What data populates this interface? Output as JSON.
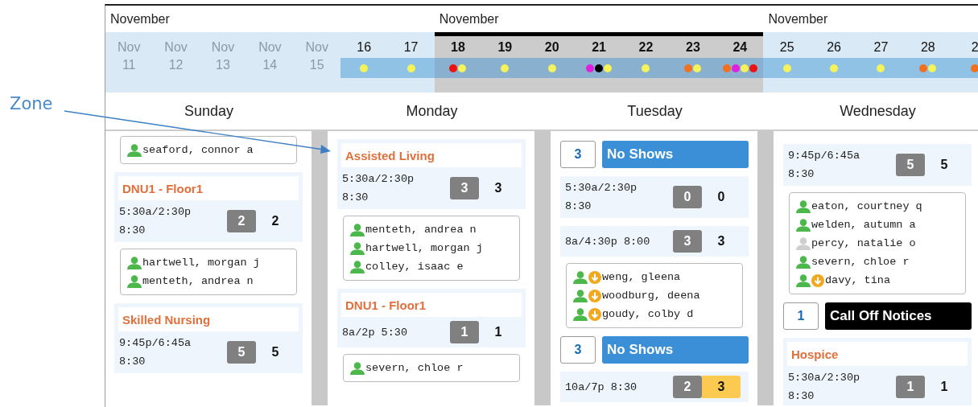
{
  "annotation": {
    "label": "Zone"
  },
  "months": [
    {
      "label": "November"
    },
    {
      "label": "November"
    },
    {
      "label": "November"
    }
  ],
  "dates": [
    {
      "month": "Nov",
      "day": "11",
      "available": false,
      "selected": false
    },
    {
      "month": "Nov",
      "day": "12",
      "available": false,
      "selected": false
    },
    {
      "month": "Nov",
      "day": "13",
      "available": false,
      "selected": false
    },
    {
      "month": "Nov",
      "day": "14",
      "available": false,
      "selected": false
    },
    {
      "month": "Nov",
      "day": "15",
      "available": false,
      "selected": false
    },
    {
      "day": "16",
      "available": true,
      "selected": false,
      "dots": [
        {
          "color": "#f4f45a"
        }
      ]
    },
    {
      "day": "17",
      "available": true,
      "selected": false,
      "dots": [
        {
          "color": "#f4f45a"
        }
      ]
    },
    {
      "day": "18",
      "available": true,
      "selected": true,
      "dots": [
        {
          "color": "#ee1111"
        },
        {
          "color": "#f4f45a"
        }
      ]
    },
    {
      "day": "19",
      "available": true,
      "selected": true,
      "dots": [
        {
          "color": "#f4f45a"
        }
      ]
    },
    {
      "day": "20",
      "available": true,
      "selected": true,
      "dots": [
        {
          "color": "#f4f45a"
        }
      ]
    },
    {
      "day": "21",
      "available": true,
      "selected": true,
      "dots": [
        {
          "color": "#e020e0"
        },
        {
          "color": "#000000"
        },
        {
          "color": "#f4f45a"
        }
      ]
    },
    {
      "day": "22",
      "available": true,
      "selected": true,
      "dots": [
        {
          "color": "#f4f45a"
        }
      ]
    },
    {
      "day": "23",
      "available": true,
      "selected": true,
      "dots": [
        {
          "color": "#f07020"
        },
        {
          "color": "#f4f45a"
        }
      ]
    },
    {
      "day": "24",
      "available": true,
      "selected": true,
      "dots": [
        {
          "color": "#f07020"
        },
        {
          "color": "#e020e0"
        },
        {
          "color": "#f4f45a"
        },
        {
          "color": "#ee1111"
        }
      ]
    },
    {
      "day": "25",
      "available": true,
      "selected": false,
      "dots": [
        {
          "color": "#f4f45a"
        }
      ]
    },
    {
      "day": "26",
      "available": true,
      "selected": false,
      "dots": [
        {
          "color": "#f4f45a"
        }
      ]
    },
    {
      "day": "27",
      "available": true,
      "selected": false,
      "dots": [
        {
          "color": "#f4f45a"
        }
      ]
    },
    {
      "day": "28",
      "available": true,
      "selected": false,
      "dots": [
        {
          "color": "#f07020"
        },
        {
          "color": "#f4f45a"
        }
      ]
    },
    {
      "day": "2",
      "available": true,
      "selected": false,
      "dots": [
        {
          "color": "#f07020"
        }
      ]
    }
  ],
  "days": [
    {
      "name": "Sunday",
      "items": [
        {
          "kind": "staff",
          "people": [
            {
              "name": "seaford, connor a",
              "active": true,
              "alert": false
            }
          ]
        },
        {
          "kind": "unit",
          "title": "DNU1 - Floor1"
        },
        {
          "kind": "shift",
          "time": "5:30a/2:30p 8:30",
          "count": "2",
          "total": "2",
          "flagged": false
        },
        {
          "kind": "staff",
          "people": [
            {
              "name": "hartwell, morgan j",
              "active": true,
              "alert": false
            },
            {
              "name": "menteth, andrea n",
              "active": true,
              "alert": false
            }
          ]
        },
        {
          "kind": "unit",
          "title": "Skilled Nursing"
        },
        {
          "kind": "shift",
          "time": "9:45p/6:45a 8:30",
          "count": "5",
          "total": "5",
          "flagged": false
        }
      ]
    },
    {
      "name": "Monday",
      "items": [
        {
          "kind": "unit",
          "title": "Assisted Living"
        },
        {
          "kind": "shift",
          "time": "5:30a/2:30p 8:30",
          "count": "3",
          "total": "3",
          "flagged": false
        },
        {
          "kind": "staff",
          "people": [
            {
              "name": "menteth, andrea n",
              "active": true,
              "alert": false
            },
            {
              "name": "hartwell, morgan j",
              "active": true,
              "alert": false
            },
            {
              "name": "colley, isaac e",
              "active": true,
              "alert": false
            }
          ]
        },
        {
          "kind": "unit",
          "title": "DNU1 - Floor1"
        },
        {
          "kind": "shift",
          "time": "8a/2p 5:30",
          "count": "1",
          "total": "1",
          "flagged": false
        },
        {
          "kind": "staff",
          "people": [
            {
              "name": "severn, chloe r",
              "active": true,
              "alert": false
            }
          ]
        }
      ]
    },
    {
      "name": "Tuesday",
      "items": [
        {
          "kind": "notice",
          "count": "3",
          "label": "No Shows",
          "color": "#3a8fd6"
        },
        {
          "kind": "shift",
          "time": "5:30a/2:30p 8:30",
          "count": "0",
          "total": "0",
          "flagged": false
        },
        {
          "kind": "shift",
          "time": "8a/4:30p 8:00",
          "count": "3",
          "total": "3",
          "flagged": false
        },
        {
          "kind": "staff",
          "people": [
            {
              "name": "weng, gleena",
              "active": true,
              "alert": true
            },
            {
              "name": "woodburg, deena",
              "active": true,
              "alert": true
            },
            {
              "name": "goudy, colby d",
              "active": true,
              "alert": true
            }
          ]
        },
        {
          "kind": "notice",
          "count": "3",
          "label": "No Shows",
          "color": "#3a8fd6"
        },
        {
          "kind": "shift",
          "time": "10a/7p 8:30",
          "count": "2",
          "total": "3",
          "flagged": true
        }
      ]
    },
    {
      "name": "Wednesday",
      "items": [
        {
          "kind": "shift",
          "time": "9:45p/6:45a 8:30",
          "count": "5",
          "total": "5",
          "flagged": false
        },
        {
          "kind": "staff",
          "people": [
            {
              "name": "eaton, courtney q",
              "active": true,
              "alert": false
            },
            {
              "name": "welden, autumn a",
              "active": true,
              "alert": false
            },
            {
              "name": "percy, natalie o",
              "active": false,
              "alert": false
            },
            {
              "name": "severn, chloe r",
              "active": true,
              "alert": false
            },
            {
              "name": "davy, tina",
              "active": true,
              "alert": true
            }
          ]
        },
        {
          "kind": "notice",
          "count": "1",
          "label": "Call Off Notices",
          "color": "#000000"
        },
        {
          "kind": "unit",
          "title": "Hospice"
        },
        {
          "kind": "shift",
          "time": "5:30a/2:30p 8:30",
          "count": "1",
          "total": "1",
          "flagged": false
        }
      ]
    }
  ]
}
